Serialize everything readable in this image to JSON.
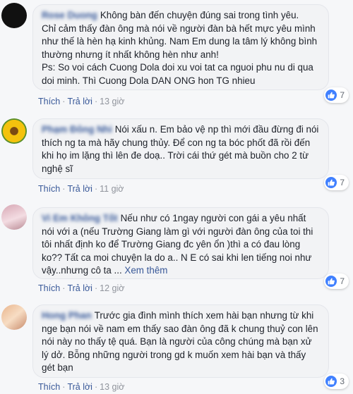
{
  "comments": [
    {
      "author": "Rose Duong",
      "text": "Không bàn đến chuyện đúng sai trong tình yêu.\nChỉ cảm thấy đàn ông mà nói về người đàn bà hết mực yêu mình như thế là hèn hạ kinh khủng. Nam Em dung la tâm lý không bình thường nhưng ít nhất không hèn như anh!\nPs: So voi cách Cuong Dola doi xu voi tat ca nguoi phu nu di qua doi minh. Thì Cuong Dola DAN ONG hon TG nhieu",
      "like_label": "Thích",
      "reply_label": "Trả lời",
      "time": "13 giờ",
      "reactions": "7",
      "avatar_color": "#111111"
    },
    {
      "author": "Phạm Đông Nhi",
      "text": "Nói xấu n. Em bảo vệ np thì mới đầu đừng đi nói thích ng ta mà hãy chung thủy. Để con ng ta bóc phốt đã rồi đến khi họ im lặng thì lên đe doạ.. Trời cái thứ gét mà buồn cho 2 từ nghệ sĩ",
      "like_label": "Thích",
      "reply_label": "Trả lời",
      "time": "11 giờ",
      "reactions": "7",
      "avatar_color": "#f2c12e"
    },
    {
      "author": "Vi Em Không Tốt",
      "text": "Nếu như có 1ngay người con gái a yêu nhất nói với a (nếu Trường Giang làm gì với người đàn ông của toi thi tôi nhất định ko để Trường Giang đc yên ổn )thì a có đau lòng ko?? Tất ca moi chuyện la do a.. N E có sai khi len tiếng noi như vậy..nhưng cô ta ...",
      "see_more": "Xem thêm",
      "like_label": "Thích",
      "reply_label": "Trả lời",
      "time": "12 giờ",
      "reactions": "7",
      "avatar_color": "#e8b6c0"
    },
    {
      "author": "Hong Phan",
      "text": "Trước gia đình mình thích xem hài bạn nhưng từ khi nge bạn nói về nam em thấy sao đàn ông đã k chung thuỷ con lên nói này no thấy tệ quá. Bạn là người của công chúng mà bạn xử lý dở. Bỗng những người trong gd k muốn xem hài bạn và thấy gét bạn",
      "like_label": "Thích",
      "reply_label": "Trả lời",
      "time": "13 giờ",
      "reactions": "3",
      "avatar_color": "#f0c8a8"
    }
  ]
}
